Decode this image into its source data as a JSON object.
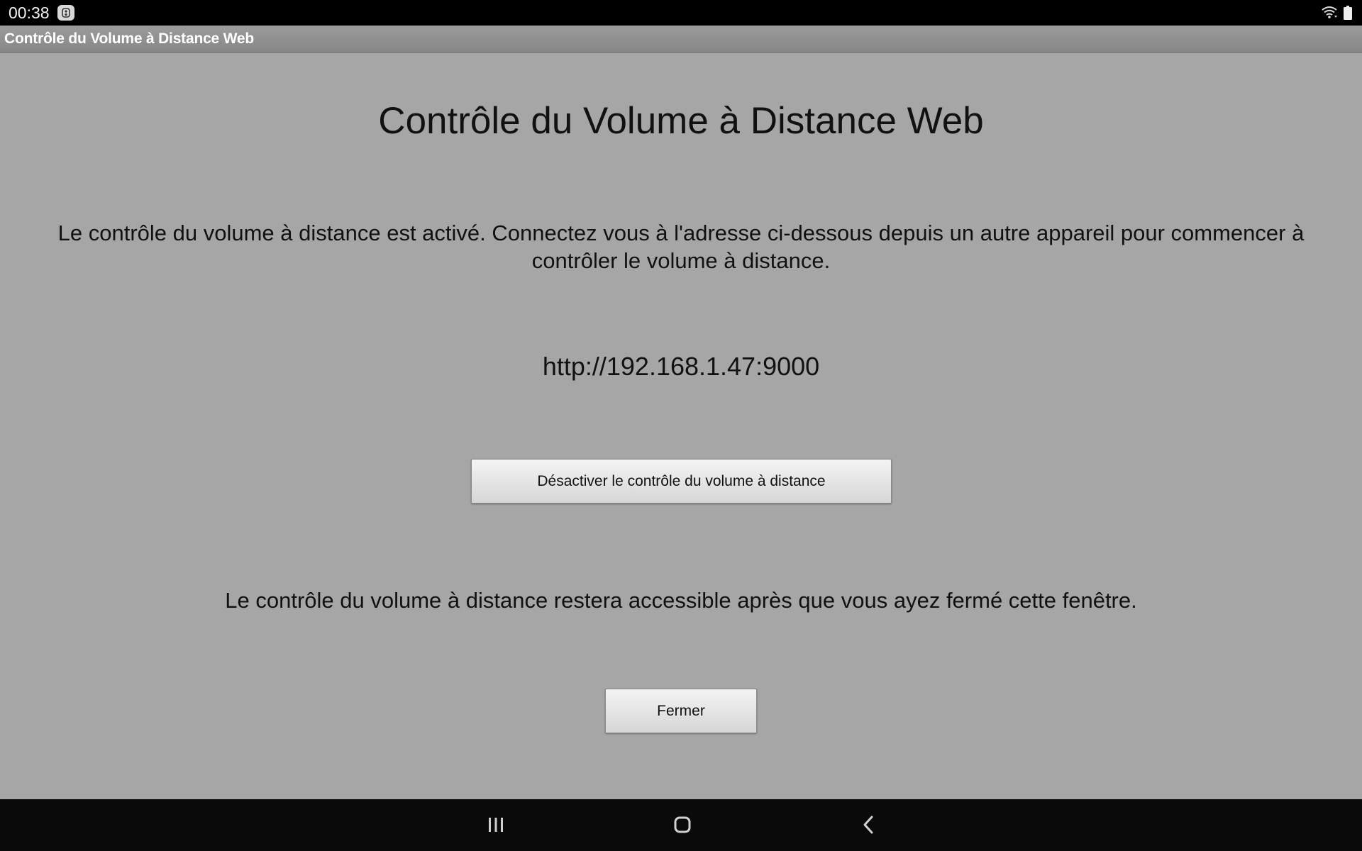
{
  "status_bar": {
    "time": "00:38",
    "notification_icon": "app-notification-icon",
    "wifi_icon": "wifi-icon",
    "battery_icon": "battery-icon"
  },
  "title_bar": {
    "title": "Contrôle du Volume à Distance Web"
  },
  "main": {
    "title": "Contrôle du Volume à Distance Web",
    "description": "Le contrôle du volume à distance est activé. Connectez vous à l'adresse ci-dessous depuis un autre appareil pour commencer à contrôler le volume à distance.",
    "address": "http://192.168.1.47:9000",
    "disable_button_label": "Désactiver le contrôle du volume à distance",
    "note": "Le contrôle du volume à distance restera accessible après que vous ayez fermé cette fenêtre.",
    "close_button_label": "Fermer"
  },
  "nav_bar": {
    "recents_icon": "recents-icon",
    "home_icon": "home-icon",
    "back_icon": "back-icon"
  }
}
